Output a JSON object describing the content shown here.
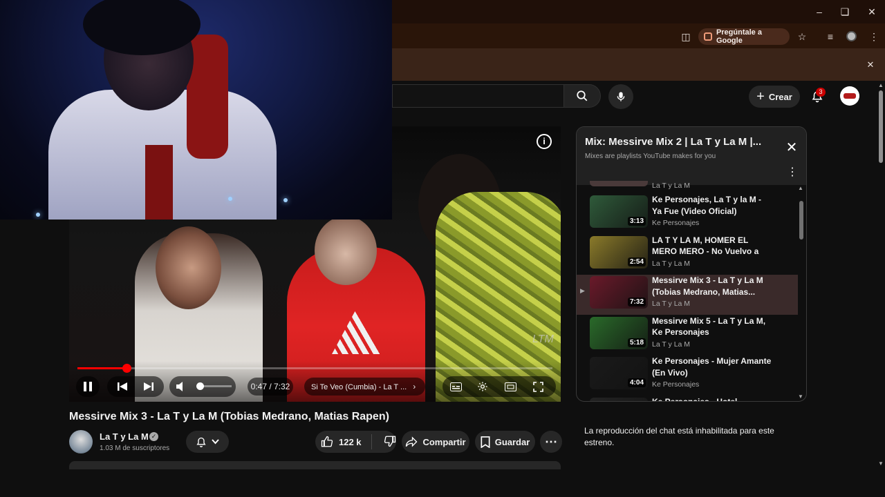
{
  "browser": {
    "ask_google_label": "Pregúntale a Google",
    "icons": [
      "minimize-icon",
      "restore-icon",
      "close-icon",
      "install-icon",
      "star-icon",
      "media-icon",
      "more-icon"
    ]
  },
  "topbar": {
    "create_label": "Crear",
    "notification_count": "3"
  },
  "player": {
    "time": "0:47 / 7:32",
    "chapter": "Si Te Veo (Cumbia) - La T ...",
    "progress_fraction": 0.104,
    "volume_fraction": 0.0,
    "watermark": "LTM"
  },
  "video": {
    "title": "Messirve Mix 3 - La T y La M (Tobias Medrano, Matias Rapen)",
    "channel": "La T y La M",
    "subscribers": "1.03 M de suscriptores",
    "likes": "122 k",
    "share_label": "Compartir",
    "save_label": "Guardar"
  },
  "mix": {
    "title": "Mix: Messirve Mix 2 | La T y La M |...",
    "subtitle": "Mixes are playlists YouTube makes for you",
    "partial_top_channel": "La T y La M",
    "items": [
      {
        "title": "Ke Personajes, La T y la M - Ya Fue (Video Oficial)",
        "channel": "Ke Personajes",
        "duration": "3:13",
        "color": "#2f5a3a",
        "active": false
      },
      {
        "title": "LA T Y LA M, HOMER EL MERO MERO - No Vuelvo a Caer...",
        "channel": "La T y La M",
        "duration": "2:54",
        "color": "#8a7a2a",
        "active": false
      },
      {
        "title": "Messirve Mix 3 - La T y La M (Tobias Medrano, Matias...",
        "channel": "La T y La M",
        "duration": "7:32",
        "color": "#6a1a2a",
        "active": true
      },
      {
        "title": "Messirve Mix 5 - La T y La M, Ke Personajes",
        "channel": "La T y La M",
        "duration": "5:18",
        "color": "#2a6a2a",
        "active": false
      },
      {
        "title": "Ke Personajes - Mujer Amante (En Vivo)",
        "channel": "Ke Personajes",
        "duration": "4:04",
        "color": "#1a1a1a",
        "active": false
      },
      {
        "title": "Ke Personajes - Hotel",
        "channel": "",
        "duration": "",
        "color": "#222222",
        "active": false
      }
    ]
  },
  "chat": {
    "disabled_text": "La reproducción del chat está inhabilitada para este estreno."
  }
}
